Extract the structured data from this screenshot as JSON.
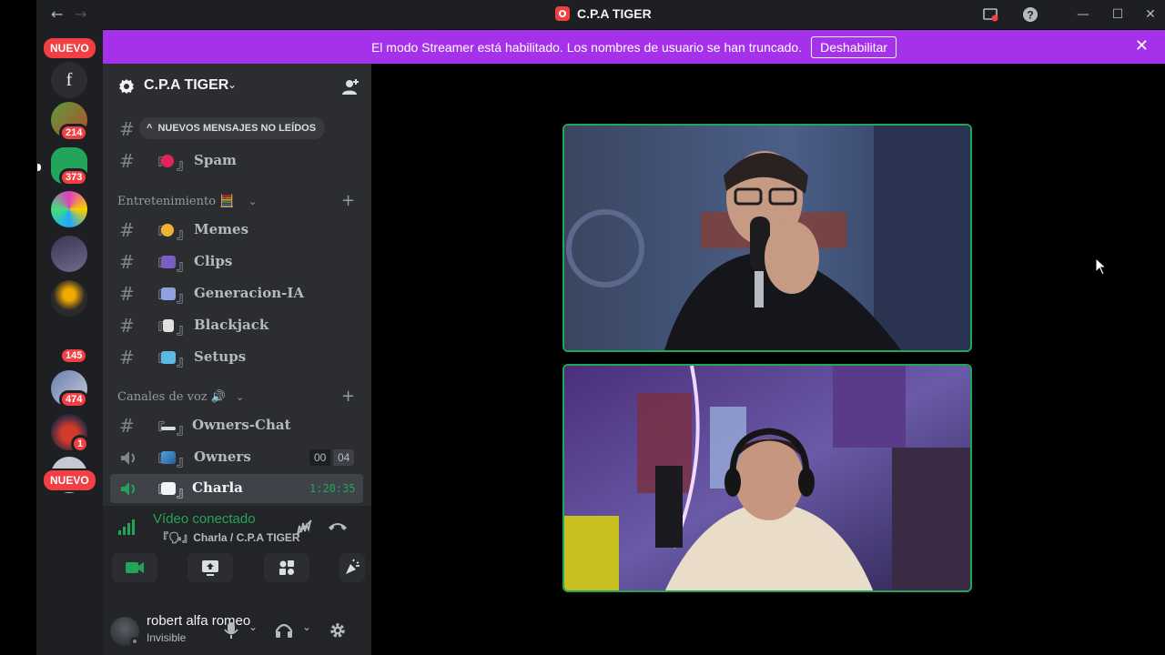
{
  "window": {
    "title": "C.P.A TIGER",
    "back": "←",
    "forward": "→",
    "minimize": "—",
    "maximize": "☐",
    "close": "✕"
  },
  "banner": {
    "text": "El modo Streamer está habilitado. Los nombres de usuario se han truncado.",
    "button": "Deshabilitar",
    "close": "✕"
  },
  "servers": {
    "new_badge_top": "NUEVO",
    "new_badge_bottom": "NUEVO",
    "letter_server": "f",
    "badges": [
      "214",
      "373",
      "145",
      "474",
      "1"
    ]
  },
  "guild": {
    "name": "C.P.A TIGER",
    "chevron": "⌄"
  },
  "channels": {
    "unread_pill": "NUEVOS MENSAJES NO LEÍDOS",
    "unread_arrow": "^",
    "hash": "#",
    "bracket_open": "『",
    "bracket_close": "』",
    "top": [
      {
        "name": "Spam",
        "emoji_color": "#e3245c"
      }
    ],
    "category_1": {
      "label": "Entretenimiento 🧮",
      "chevron": "⌄",
      "plus": "+"
    },
    "entertainment": [
      {
        "name": "Memes",
        "emoji_color": "#f0b232"
      },
      {
        "name": "Clips",
        "emoji_color": "#7a5fc0"
      },
      {
        "name": "Generacion-IA",
        "emoji_color": "#8ea1e1"
      },
      {
        "name": "Blackjack",
        "emoji_color": "#e0e0e0"
      },
      {
        "name": "Setups",
        "emoji_color": "#5cb8e4"
      }
    ],
    "category_2": {
      "label": "Canales de voz 🔊",
      "chevron": "⌄",
      "plus": "+"
    },
    "voice": [
      {
        "name": "Owners-Chat",
        "emoji_color": "#dbdee1"
      },
      {
        "name": "Owners",
        "emoji_color": "#4aa3df",
        "count_a": "00",
        "count_b": "04"
      },
      {
        "name": "Charla",
        "emoji_color": "#f2f3f5",
        "timer": "1:20:35"
      }
    ]
  },
  "voice_panel": {
    "status": "Vídeo conectado",
    "channel": "『🗣』Charla / C.P.A TIGER"
  },
  "user": {
    "name": "robert alfa romeo",
    "status": "Invisible"
  },
  "colors": {
    "accent_green": "#23a559",
    "banner_purple": "#a532ea",
    "badge_red": "#f23f43"
  }
}
